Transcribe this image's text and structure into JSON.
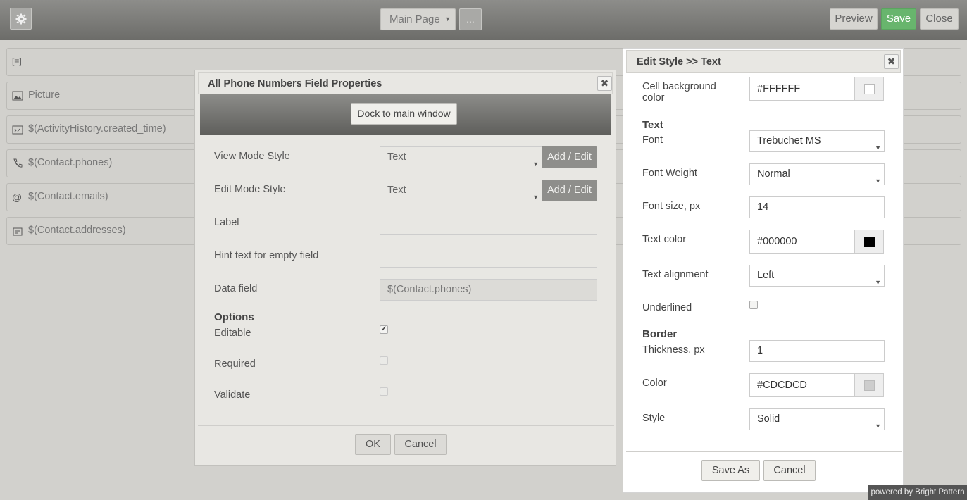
{
  "topbar": {
    "page_select": "Main Page",
    "more_label": "...",
    "preview_label": "Preview",
    "save_label": "Save",
    "close_label": "Close"
  },
  "field_list": [
    {
      "icon": "text-box-icon",
      "label": ""
    },
    {
      "icon": "picture-icon",
      "label": "Picture"
    },
    {
      "icon": "datetime-icon",
      "label": "$(ActivityHistory.created_time)"
    },
    {
      "icon": "phone-icon",
      "label": "$(Contact.phones)"
    },
    {
      "icon": "email-icon",
      "label": "$(Contact.emails)"
    },
    {
      "icon": "address-icon",
      "label": "$(Contact.addresses)"
    }
  ],
  "props_dialog": {
    "title": "All Phone Numbers Field Properties",
    "dock_label": "Dock to main window",
    "view_mode_label": "View Mode Style",
    "view_mode_value": "Text",
    "edit_mode_label": "Edit Mode Style",
    "edit_mode_value": "Text",
    "add_edit_label": "Add / Edit",
    "label_label": "Label",
    "label_value": "",
    "hint_label": "Hint text for empty field",
    "hint_value": "",
    "data_field_label": "Data field",
    "data_field_value": "$(Contact.phones)",
    "options_title": "Options",
    "editable_label": "Editable",
    "editable_checked": true,
    "required_label": "Required",
    "required_checked": false,
    "validate_label": "Validate",
    "validate_checked": false,
    "ok_label": "OK",
    "cancel_label": "Cancel"
  },
  "style_dialog": {
    "title": "Edit Style >> Text",
    "cell_bg_label": "Cell background color",
    "cell_bg_value": "#FFFFFF",
    "cell_bg_color": "#FFFFFF",
    "text_section": "Text",
    "font_label": "Font",
    "font_value": "Trebuchet MS",
    "font_weight_label": "Font Weight",
    "font_weight_value": "Normal",
    "font_size_label": "Font size, px",
    "font_size_value": "14",
    "text_color_label": "Text color",
    "text_color_value": "#000000",
    "text_color_color": "#000000",
    "text_align_label": "Text alignment",
    "text_align_value": "Left",
    "underlined_label": "Underlined",
    "underlined_checked": false,
    "border_section": "Border",
    "thickness_label": "Thickness, px",
    "thickness_value": "1",
    "color_label": "Color",
    "color_value": "#CDCDCD",
    "color_color": "#CDCDCD",
    "style_label": "Style",
    "style_value": "Solid",
    "save_as_label": "Save As",
    "cancel_label": "Cancel"
  },
  "powered_by": "powered by Bright Pattern"
}
